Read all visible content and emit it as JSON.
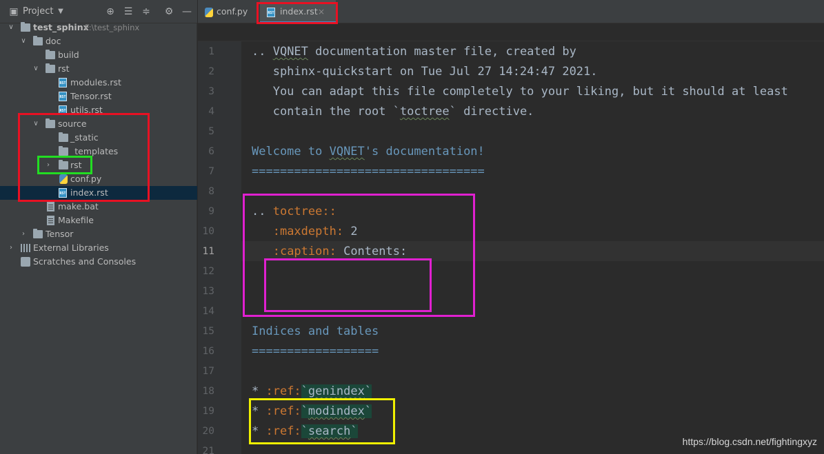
{
  "project_panel": {
    "title": "Project",
    "toolbar_icons": [
      "locate-icon",
      "expand-all-icon",
      "collapse-all-icon",
      "gear-icon",
      "minimize-icon"
    ],
    "tree": [
      {
        "label": "test_sphinx",
        "path_hint": "F:\\test_sphinx",
        "icon": "folder-icon",
        "level": 0,
        "expanded": true
      },
      {
        "label": "doc",
        "icon": "folder-icon",
        "level": 1,
        "expanded": true
      },
      {
        "label": "build",
        "icon": "folder-icon",
        "level": 2
      },
      {
        "label": "rst",
        "icon": "folder-icon",
        "level": 2,
        "expanded": true
      },
      {
        "label": "modules.rst",
        "icon": "rst-file-icon",
        "level": 3
      },
      {
        "label": "Tensor.rst",
        "icon": "rst-file-icon",
        "level": 3
      },
      {
        "label": "utils.rst",
        "icon": "rst-file-icon",
        "level": 3
      },
      {
        "label": "source",
        "icon": "folder-icon",
        "level": 2,
        "expanded": true
      },
      {
        "label": "_static",
        "icon": "folder-icon",
        "level": 3
      },
      {
        "label": "_templates",
        "icon": "folder-icon",
        "level": 3
      },
      {
        "label": "rst",
        "icon": "folder-icon",
        "level": 3,
        "expanded": false
      },
      {
        "label": "conf.py",
        "icon": "python-file-icon",
        "level": 3
      },
      {
        "label": "index.rst",
        "icon": "rst-file-icon",
        "level": 3,
        "selected": true
      },
      {
        "label": "make.bat",
        "icon": "bat-file-icon",
        "level": 2
      },
      {
        "label": "Makefile",
        "icon": "text-file-icon",
        "level": 2
      },
      {
        "label": "Tensor",
        "icon": "folder-icon",
        "level": 1,
        "expanded": false
      },
      {
        "label": "External Libraries",
        "icon": "library-icon",
        "level": 0,
        "expanded": false
      },
      {
        "label": "Scratches and Consoles",
        "icon": "scratches-icon",
        "level": 0
      }
    ]
  },
  "tabs": [
    {
      "label": "conf.py",
      "icon": "python-file-icon",
      "active": false
    },
    {
      "label": "index.rst",
      "icon": "rst-file-icon",
      "active": true,
      "close": "×"
    }
  ],
  "editor": {
    "current_line": 11,
    "line_numbers": [
      "1",
      "2",
      "3",
      "4",
      "5",
      "6",
      "7",
      "8",
      "9",
      "10",
      "11",
      "12",
      "13",
      "14",
      "15",
      "16",
      "17",
      "18",
      "19",
      "20",
      "21"
    ],
    "lines": [
      ".. VQNET documentation master file, created by",
      "   sphinx-quickstart on Tue Jul 27 14:24:47 2021.",
      "   You can adapt this file completely to your liking, but it should at least",
      "   contain the root `toctree` directive.",
      "",
      "Welcome to VQNET's documentation!",
      "=================================",
      "",
      ".. toctree::",
      "   :maxdepth: 2",
      "   :caption: Contents:",
      "",
      "",
      "",
      "Indices and tables",
      "==================",
      "",
      "* :ref:`genindex`",
      "* :ref:`modindex`",
      "* :ref:`search`",
      ""
    ]
  },
  "annotation_colors": {
    "tab_box": "#e81123",
    "source_box": "#e81123",
    "rst_box": "#22dd22",
    "toctree_box": "#e020d0",
    "empty_box": "#e020d0",
    "refs_box": "#f0f000"
  },
  "watermark": "https://blog.csdn.net/fightingxyz"
}
